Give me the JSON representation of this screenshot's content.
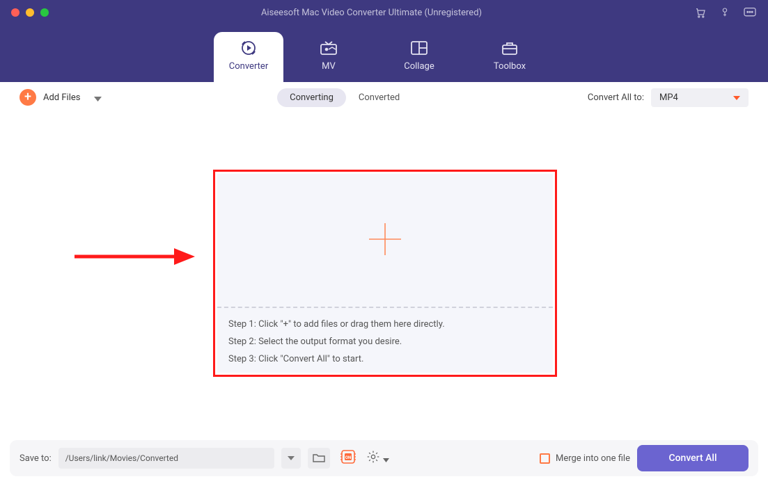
{
  "title": "Aiseesoft Mac Video Converter Ultimate (Unregistered)",
  "tabs": {
    "converter": "Converter",
    "mv": "MV",
    "collage": "Collage",
    "toolbox": "Toolbox"
  },
  "toolbar": {
    "add_files_label": "Add Files",
    "seg_converting": "Converting",
    "seg_converted": "Converted",
    "convert_all_to_label": "Convert All to:",
    "format_selected": "MP4"
  },
  "dropzone": {
    "step1": "Step 1: Click \"+\" to add files or drag them here directly.",
    "step2": "Step 2: Select the output format you desire.",
    "step3": "Step 3: Click \"Convert All\" to start."
  },
  "bottom": {
    "save_to_label": "Save to:",
    "save_path": "/Users/link/Movies/Converted",
    "merge_label": "Merge into one file",
    "convert_all_button": "Convert All"
  },
  "colors": {
    "titlebar_bg": "#3e3980",
    "accent_orange": "#ff7a45",
    "primary_button": "#6b64d0",
    "highlight_red": "#ff1a1a"
  }
}
